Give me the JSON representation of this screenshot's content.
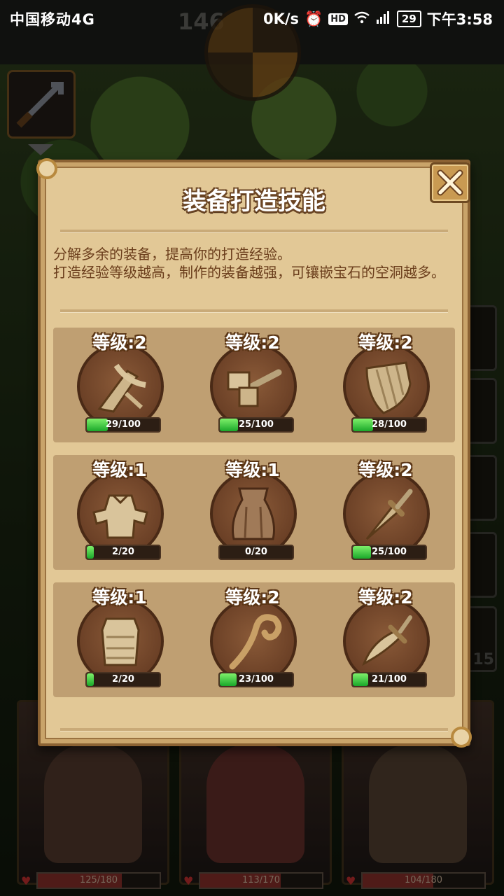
{
  "status_bar": {
    "carrier": "中国移动4G",
    "net_speed": "0K/s",
    "hd": "HD",
    "battery": "29",
    "time": "下午3:58"
  },
  "hud": {
    "level_number": "146",
    "side_count": "15"
  },
  "dialog": {
    "title": "装备打造技能",
    "description": "分解多余的装备，提高你的打造经验。\n打造经验等级越高，制作的装备越强，可镶嵌宝石的空洞越多。",
    "close_icon": "close-icon"
  },
  "skills": [
    {
      "icon": "crossbow-icon",
      "level": "等级:2",
      "progress": "29/100",
      "fraction": 0.29
    },
    {
      "icon": "hammer-icon",
      "level": "等级:2",
      "progress": "25/100",
      "fraction": 0.25
    },
    {
      "icon": "shield-icon",
      "level": "等级:2",
      "progress": "28/100",
      "fraction": 0.28
    },
    {
      "icon": "plate-armor-icon",
      "level": "等级:1",
      "progress": "2/20",
      "fraction": 0.1
    },
    {
      "icon": "cloak-icon",
      "level": "等级:1",
      "progress": "0/20",
      "fraction": 0.0
    },
    {
      "icon": "dagger-icon",
      "level": "等级:2",
      "progress": "25/100",
      "fraction": 0.25
    },
    {
      "icon": "leather-armor-icon",
      "level": "等级:1",
      "progress": "2/20",
      "fraction": 0.1
    },
    {
      "icon": "staff-icon",
      "level": "等级:2",
      "progress": "23/100",
      "fraction": 0.23
    },
    {
      "icon": "curved-blade-icon",
      "level": "等级:2",
      "progress": "21/100",
      "fraction": 0.21
    }
  ],
  "heroes": [
    {
      "hp": "125/180",
      "fraction": 0.69
    },
    {
      "hp": "113/170",
      "fraction": 0.66
    },
    {
      "hp": "104/180",
      "fraction": 0.58
    }
  ]
}
